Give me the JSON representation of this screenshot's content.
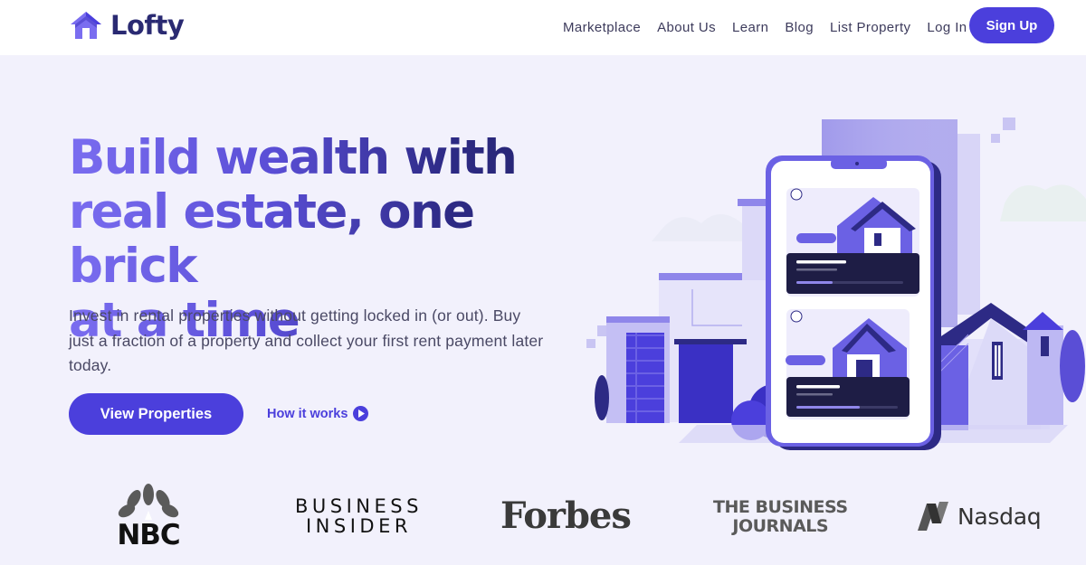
{
  "brand": {
    "name": "Lofty",
    "accent": "#4b3fdc",
    "logo_icon": "house-logo-icon"
  },
  "nav": {
    "items": [
      {
        "label": "Marketplace"
      },
      {
        "label": "About Us"
      },
      {
        "label": "Learn"
      },
      {
        "label": "Blog"
      },
      {
        "label": "List Property"
      },
      {
        "label": "Log In"
      }
    ],
    "signup_label": "Sign Up"
  },
  "hero": {
    "title_line1": "Build wealth with",
    "title_line2": "real estate, one brick",
    "title_line3": "at a time",
    "subtitle": "Invest in rental properties without getting locked in (or out). Buy just a fraction of a property and collect your first rent payment later today.",
    "cta_label": "View Properties",
    "secondary_label": "How it works",
    "secondary_icon": "play-circle-icon"
  },
  "press": {
    "nbc": "NBC",
    "business_insider_line1": "BUSINESS",
    "business_insider_line2": "INSIDER",
    "forbes": "Forbes",
    "tbj_line1": "THE BUSINESS",
    "tbj_line2": "JOURNALS",
    "nasdaq": "Nasdaq"
  },
  "colors": {
    "background": "#f2f1fc",
    "header": "#ffffff",
    "title_gradient_start": "#7a6df0",
    "title_gradient_end": "#24236b",
    "phone_dark": "#1e1d45"
  }
}
